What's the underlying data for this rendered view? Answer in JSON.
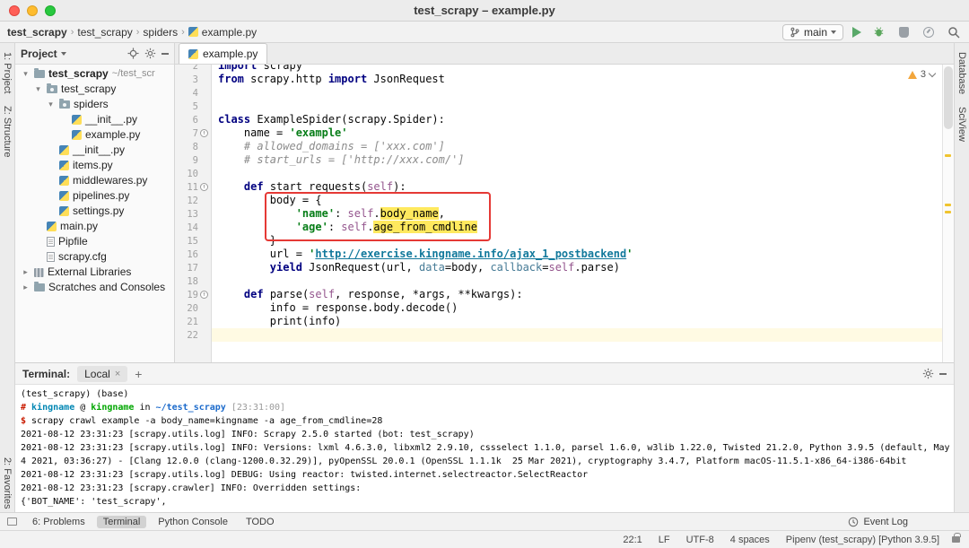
{
  "titlebar": {
    "title": "test_scrapy – example.py"
  },
  "navbar": {
    "breadcrumbs": [
      "test_scrapy",
      "test_scrapy",
      "spiders",
      "example.py"
    ],
    "branch_label": "main"
  },
  "stripes": {
    "left_top": [
      "1: Project",
      "Z: Structure"
    ],
    "left_bottom": [
      "2: Favorites"
    ],
    "right_top": [
      "Database",
      "SciView"
    ]
  },
  "project_panel": {
    "title": "Project",
    "tree": [
      {
        "label": "test_scrapy",
        "suffix": "~/test_scr",
        "level": 0,
        "expanded": true,
        "icon": "folder",
        "bold": true
      },
      {
        "label": "test_scrapy",
        "level": 1,
        "expanded": true,
        "icon": "package"
      },
      {
        "label": "spiders",
        "level": 2,
        "expanded": true,
        "icon": "package"
      },
      {
        "label": "__init__.py",
        "level": 3,
        "icon": "python"
      },
      {
        "label": "example.py",
        "level": 3,
        "icon": "python"
      },
      {
        "label": "__init__.py",
        "level": 2,
        "icon": "python"
      },
      {
        "label": "items.py",
        "level": 2,
        "icon": "python"
      },
      {
        "label": "middlewares.py",
        "level": 2,
        "icon": "python"
      },
      {
        "label": "pipelines.py",
        "level": 2,
        "icon": "python"
      },
      {
        "label": "settings.py",
        "level": 2,
        "icon": "python"
      },
      {
        "label": "main.py",
        "level": 1,
        "icon": "python"
      },
      {
        "label": "Pipfile",
        "level": 1,
        "icon": "file"
      },
      {
        "label": "scrapy.cfg",
        "level": 1,
        "icon": "config"
      },
      {
        "label": "External Libraries",
        "level": 0,
        "expanded": false,
        "icon": "libs"
      },
      {
        "label": "Scratches and Consoles",
        "level": 0,
        "expanded": false,
        "icon": "scratch"
      }
    ]
  },
  "editor": {
    "tab_label": "example.py",
    "warning_count": "3",
    "code_lines": [
      {
        "n": 2,
        "tokens": [
          [
            "kw",
            "import"
          ],
          [
            "p",
            " scrapy"
          ]
        ]
      },
      {
        "n": 3,
        "tokens": [
          [
            "kw",
            "from"
          ],
          [
            "p",
            " scrapy.http "
          ],
          [
            "kw",
            "import"
          ],
          [
            "p",
            " JsonRequest"
          ]
        ]
      },
      {
        "n": 4,
        "tokens": []
      },
      {
        "n": 5,
        "tokens": []
      },
      {
        "n": 6,
        "tokens": [
          [
            "kw",
            "class"
          ],
          [
            "p",
            " ExampleSpider(scrapy.Spider):"
          ]
        ]
      },
      {
        "n": 7,
        "marker": true,
        "tokens": [
          [
            "p",
            "    name = "
          ],
          [
            "str",
            "'example'"
          ]
        ]
      },
      {
        "n": 8,
        "tokens": [
          [
            "cmt",
            "    # allowed_domains = ['xxx.com']"
          ]
        ]
      },
      {
        "n": 9,
        "tokens": [
          [
            "cmt",
            "    # start_urls = ['http://xxx.com/']"
          ]
        ]
      },
      {
        "n": 10,
        "tokens": []
      },
      {
        "n": 11,
        "marker": true,
        "tokens": [
          [
            "p",
            "    "
          ],
          [
            "kw",
            "def"
          ],
          [
            "p",
            " start_requests("
          ],
          [
            "self",
            "self"
          ],
          [
            "p",
            "):"
          ]
        ]
      },
      {
        "n": 12,
        "tokens": [
          [
            "p",
            "        body = {"
          ]
        ]
      },
      {
        "n": 13,
        "tokens": [
          [
            "p",
            "            "
          ],
          [
            "str",
            "'name'"
          ],
          [
            "p",
            ": "
          ],
          [
            "self",
            "self"
          ],
          [
            "p",
            "."
          ],
          [
            "hl",
            "body_name"
          ],
          [
            "p",
            ","
          ]
        ]
      },
      {
        "n": 14,
        "tokens": [
          [
            "p",
            "            "
          ],
          [
            "str",
            "'age'"
          ],
          [
            "p",
            ": "
          ],
          [
            "self",
            "self"
          ],
          [
            "p",
            "."
          ],
          [
            "hl",
            "age_from_cmdline"
          ]
        ]
      },
      {
        "n": 15,
        "tokens": [
          [
            "p",
            "        }"
          ]
        ]
      },
      {
        "n": 16,
        "tokens": [
          [
            "p",
            "        url = "
          ],
          [
            "str",
            "'"
          ],
          [
            "url",
            "http://exercise.kingname.info/ajax_1_postbackend"
          ],
          [
            "str",
            "'"
          ]
        ]
      },
      {
        "n": 17,
        "tokens": [
          [
            "p",
            "        "
          ],
          [
            "kw",
            "yield"
          ],
          [
            "p",
            " JsonRequest(url, "
          ],
          [
            "named",
            "data"
          ],
          [
            "p",
            "=body, "
          ],
          [
            "named",
            "callback"
          ],
          [
            "p",
            "="
          ],
          [
            "self",
            "self"
          ],
          [
            "p",
            ".parse)"
          ]
        ]
      },
      {
        "n": 18,
        "tokens": []
      },
      {
        "n": 19,
        "marker": true,
        "tokens": [
          [
            "p",
            "    "
          ],
          [
            "kw",
            "def"
          ],
          [
            "p",
            " parse("
          ],
          [
            "self",
            "self"
          ],
          [
            "p",
            ", response, *args, **kwargs):"
          ]
        ]
      },
      {
        "n": 20,
        "tokens": [
          [
            "p",
            "        info = response.body.decode()"
          ]
        ]
      },
      {
        "n": 21,
        "tokens": [
          [
            "p",
            "        print(info)"
          ]
        ]
      },
      {
        "n": 22,
        "current": true,
        "tokens": []
      }
    ]
  },
  "terminal": {
    "title": "Terminal:",
    "tab_label": "Local",
    "lines": [
      {
        "tokens": [
          [
            "p",
            "(test_scrapy) (base)"
          ]
        ]
      },
      {
        "tokens": [
          [
            "red",
            "# "
          ],
          [
            "cyan",
            "kingname"
          ],
          [
            "p",
            " @ "
          ],
          [
            "green",
            "kingname"
          ],
          [
            "p",
            " in "
          ],
          [
            "blue",
            "~/test_scrapy"
          ],
          [
            "p",
            " "
          ],
          [
            "gray",
            "[23:31:00]"
          ]
        ]
      },
      {
        "tokens": [
          [
            "red",
            "$ "
          ],
          [
            "p",
            "scrapy crawl example -a body_name=kingname -a age_from_cmdline=28"
          ]
        ]
      },
      {
        "tokens": [
          [
            "p",
            "2021-08-12 23:31:23 [scrapy.utils.log] INFO: Scrapy 2.5.0 started (bot: test_scrapy)"
          ]
        ]
      },
      {
        "tokens": [
          [
            "p",
            "2021-08-12 23:31:23 [scrapy.utils.log] INFO: Versions: lxml 4.6.3.0, libxml2 2.9.10, cssselect 1.1.0, parsel 1.6.0, w3lib 1.22.0, Twisted 21.2.0, Python 3.9.5 (default, May"
          ]
        ]
      },
      {
        "tokens": [
          [
            "p",
            "4 2021, 03:36:27) - [Clang 12.0.0 (clang-1200.0.32.29)], pyOpenSSL 20.0.1 (OpenSSL 1.1.1k  25 Mar 2021), cryptography 3.4.7, Platform macOS-11.5.1-x86_64-i386-64bit"
          ]
        ]
      },
      {
        "tokens": [
          [
            "p",
            "2021-08-12 23:31:23 [scrapy.utils.log] DEBUG: Using reactor: twisted.internet.selectreactor.SelectReactor"
          ]
        ]
      },
      {
        "tokens": [
          [
            "p",
            "2021-08-12 23:31:23 [scrapy.crawler] INFO: Overridden settings:"
          ]
        ]
      },
      {
        "tokens": [
          [
            "p",
            "{'BOT_NAME': 'test_scrapy',"
          ]
        ]
      }
    ]
  },
  "bottom_bar": {
    "items": [
      {
        "label": "6: Problems"
      },
      {
        "label": "Terminal",
        "active": true
      },
      {
        "label": "Python Console"
      },
      {
        "label": "TODO"
      }
    ],
    "event_log": "Event Log"
  },
  "statusbar": {
    "items": [
      "22:1",
      "LF",
      "UTF-8",
      "4 spaces",
      "Pipenv (test_scrapy) [Python 3.9.5]"
    ]
  }
}
